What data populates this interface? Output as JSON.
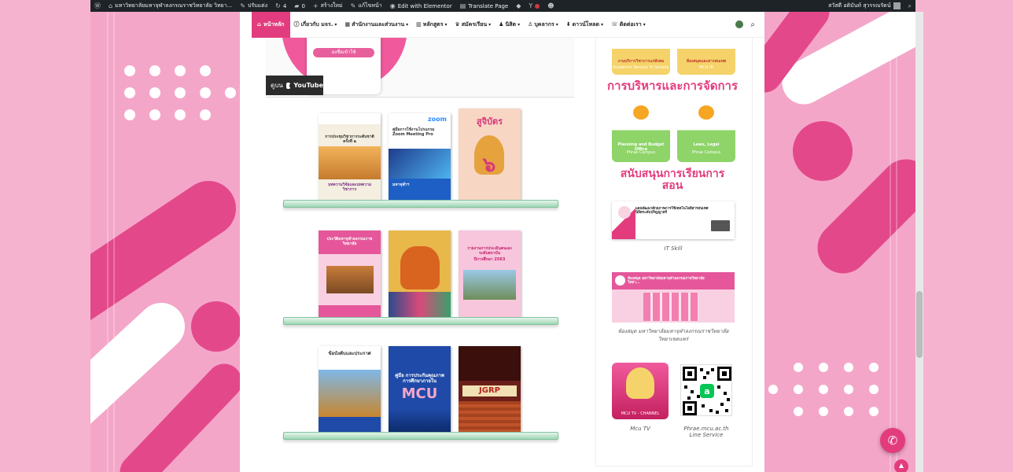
{
  "adminbar": {
    "site_title": "มหาวิทยาลัยมหาจุฬาลงกรณราชวิทยาลัย วิทยา...",
    "customize": "ปรับแต่ง",
    "updates": "4",
    "comments": "0",
    "new": "สร้างใหม่",
    "edit_page": "แก้ไขหน้า",
    "elementor": "Edit with Elementor",
    "translate": "Translate Page",
    "greeting": "สวัสดี อดิบันท์ สุวรรณรัตน์"
  },
  "nav": {
    "home": "หน้าหลัก",
    "items": [
      {
        "label": "เกี่ยวกับ มจร."
      },
      {
        "label": "สำนักงานและส่วนงาน"
      },
      {
        "label": "หลักสูตร"
      },
      {
        "label": "สมัครเรียน"
      },
      {
        "label": "นิสิต"
      },
      {
        "label": "บุคลากร"
      },
      {
        "label": "ดาวน์โหลด"
      },
      {
        "label": "ติดต่อเรา"
      }
    ]
  },
  "video": {
    "watch_on": "ดูบน",
    "youtube": "YouTube",
    "phone_button": "ลงชื่อเข้าใช้"
  },
  "books": [
    {
      "title": "การประชุมวิชาการระดับชาติ ครั้งที่ ๒",
      "subtitle": "บทความวิจัยและบทความวิชาการ",
      "bg": "#f4efe0"
    },
    {
      "title": "คู่มือการใช้งานโปรแกรม Zoom Meeting Pro",
      "header": "zoom",
      "subtitle": "มหาจุฬาฯ",
      "bg": "#ffffff"
    },
    {
      "title": "สูจิบัตร",
      "subtitle": "",
      "bg": "#f7d6c4"
    },
    {
      "title": "ประวัติมหาจุฬาลงกรณราชวิทยาลัย",
      "subtitle": "",
      "bg": "#f9d0e2"
    },
    {
      "title": "",
      "subtitle": "",
      "bg": "#e8b84a"
    },
    {
      "title": "รายงานการประเมินตนเอง ระดับสถาบัน",
      "subtitle": "ปีการศึกษา 2563",
      "bg": "#f7c6dd"
    },
    {
      "title": "ข้อบังคับและประกาศ",
      "subtitle": "",
      "bg": "#ffffff"
    },
    {
      "title": "คู่มือ การประกันคุณภาพการศึกษาภายใน",
      "brand": "MCU",
      "subtitle": "",
      "bg": "#1f4aa8"
    },
    {
      "title": "JGRP",
      "subtitle": "",
      "bg": "#6b1f1a"
    }
  ],
  "sidebar": {
    "service_cards": [
      {
        "label": "งานบริการวิชาการแก่สังคม",
        "sub": "Academic Service To Society"
      },
      {
        "label": "ห้องสมุดและสารสนเทศ",
        "sub": "MCU IR"
      }
    ],
    "management_title": "การบริหารและการจัดการ",
    "management_cards": [
      {
        "label": "Planning and Budget Office",
        "sub": "Phrae Campus"
      },
      {
        "label": "Laws, Legal",
        "sub": "Phrae Campus"
      }
    ],
    "teaching_title": "สนับสนุนการเรียนการสอน",
    "it_skill": {
      "text": "แผนพัฒนาศักยภาพการใช้เทคโนโลยีสารสนเทศนิสิตระดับปริญญาตรี",
      "caption": "IT Skill"
    },
    "library": {
      "text": "ห้องสมุด มหาวิทยาลัยมหาจุฬาลงกรณราชวิทยาลัย วิทยา...",
      "caption": "ห้องสมุด มหาวิทยาลัยมหาจุฬาลงกรณราชวิทยาลัย วิทยาเขตแพร่"
    },
    "mcu_tv": {
      "label": "MCU TV - CHANNEL",
      "caption": "Mcu TV"
    },
    "line": {
      "caption": "Phrae.mcu.ac.th Line Service"
    }
  },
  "colors": {
    "brand_pink": "#e33c7e",
    "bg_pink": "#f4a6c9",
    "admin_bar": "#1d2327"
  }
}
